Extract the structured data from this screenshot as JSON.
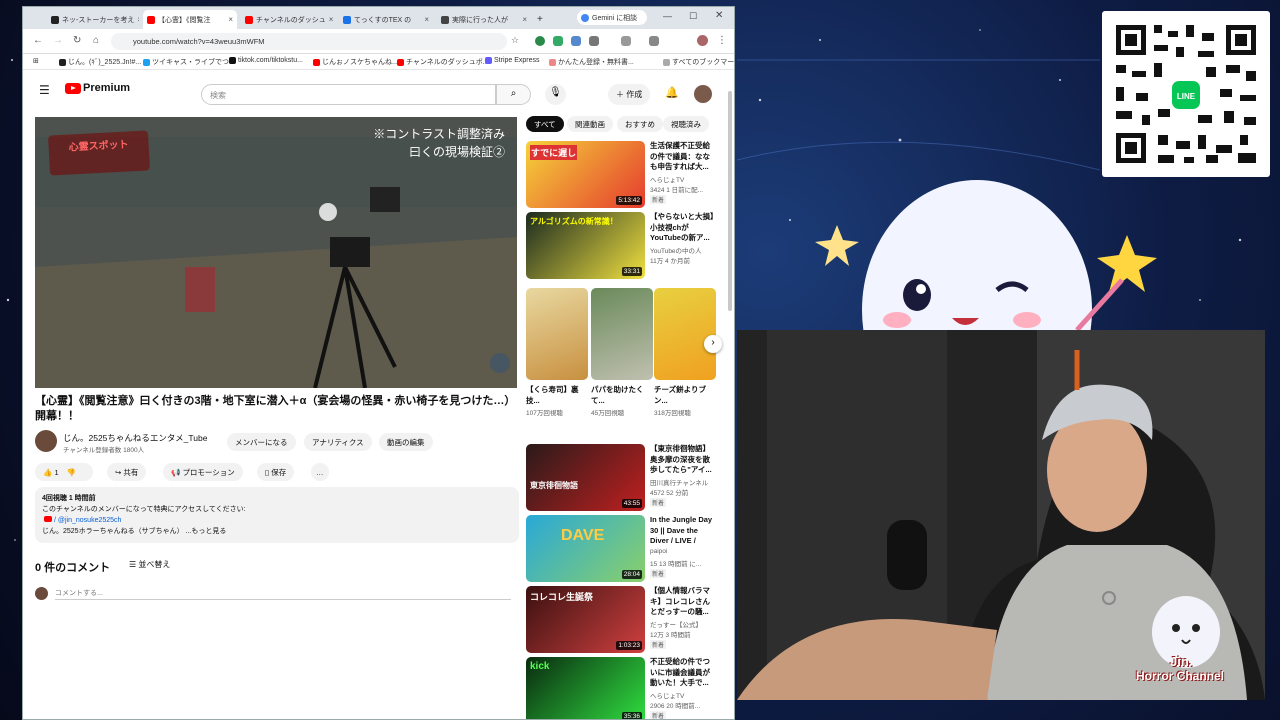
{
  "browser": {
    "tabs": [
      {
        "label": "ネッ-ストーカーを考え",
        "color": "#222"
      },
      {
        "label": "【心霊】《閲覧注",
        "color": "#f00"
      },
      {
        "label": "チャンネルのダッシュ",
        "color": "#f00"
      },
      {
        "label": "てっくすのTEX の",
        "color": "#1a73e8"
      },
      {
        "label": "実際に行った人が",
        "color": "#444"
      },
      {
        "label": "Gemini に相談",
        "color": "#4285f4"
      }
    ],
    "new_tab": "+",
    "url": "youtube.com/watch?v=43weuu3mWFM",
    "bookmarks": [
      {
        "label": "じん。(ｷﾞ)_2525.Jn!#...",
        "color": "#222"
      },
      {
        "label": "ツイキャス・ライブでつ...",
        "color": "#1da1f2"
      },
      {
        "label": "tiktok.com/tiktokstu...",
        "color": "#111"
      },
      {
        "label": "じんぉノスケちゃんね...",
        "color": "#f00"
      },
      {
        "label": "チャンネルのダッシュボ...",
        "color": "#f00"
      },
      {
        "label": "Stripe Express",
        "color": "#635bff"
      },
      {
        "label": "かんたん登録・無料書...",
        "color": "#e88"
      },
      {
        "label": "すべてのブックマーク",
        "color": "#888"
      }
    ]
  },
  "youtube": {
    "logo": "Premium",
    "search_placeholder": "検索",
    "create_label": "作成",
    "overlay_top_right": "※コントラスト調整済み",
    "overlay_sub": "曰くの現場検証②",
    "overlay_top_left": "心霊スポット",
    "video_title": "【心霊】《閲覧注意》曰く付きの3階・地下室に潜入＋α（宴会場の怪異・赤い椅子を見つけた…）開幕！！",
    "channel_name": "じん。2525ちゃんねるエンタメ_Tube",
    "subscribers": "チャンネル登録者数 1800人",
    "buttons": {
      "member": "メンバーになる",
      "analytics": "アナリティクス",
      "edit": "動画の編集",
      "like_count": "1",
      "share": "共有",
      "promote": "プロモーション",
      "save": "保存",
      "more": "…"
    },
    "description": {
      "meta": "4回視聴  1 時間前",
      "line1": "このチャンネルのメンバーになって特典にアクセスしてください:",
      "line2": "/ @jin_nosuke2525ch",
      "line3": "じん。2525ホラーちゃんねる（サブちゃん） ...もっと見る"
    },
    "comments_title": "0 件のコメント",
    "sort_label": "並べ替え",
    "comment_placeholder": "コメントする...",
    "filter_chips": [
      "すべて",
      "関連動画",
      "おすすめ",
      "視聴済み"
    ],
    "recommendations": [
      {
        "title": "生活保護不正受給の件で議員：ななも申告すれば大...",
        "channel": "へらじょTV",
        "stats": "3424 1 日前に配...",
        "badge": "新着",
        "duration": "5:13:42",
        "colors": [
          "#f5d33a",
          "#e53b2e"
        ]
      },
      {
        "title": "【やらないと大損】小技視chが YouTubeの新ア...",
        "channel": "YouTubeの中の人",
        "stats": "11万  4 か月前",
        "badge": "",
        "duration": "33:31",
        "colors": [
          "#1a2a20",
          "#f0e040"
        ]
      },
      {
        "title": "【東京徘徊物語】奥多摩の深夜を散歩してたら\"アイ...",
        "channel": "田川真行チャンネル",
        "stats": "4572  52 分前",
        "badge": "新着",
        "duration": "43:55",
        "colors": [
          "#2a1a1a",
          "#c02020"
        ]
      },
      {
        "title": "In the Jungle Day 30 || Dave the Diver / LIVE /",
        "channel": "paipoi",
        "stats": "15  13 時間前 に...",
        "badge": "新着",
        "duration": "28:04",
        "colors": [
          "#29a8d8",
          "#8ad06a"
        ]
      },
      {
        "title": "【個人情報バラマキ】コレコレさんとだっすーの騒...",
        "channel": "だっすー【公式】",
        "stats": "12万  3 時間前",
        "badge": "新着",
        "duration": "1:03:23",
        "colors": [
          "#3a1010",
          "#d04040"
        ]
      },
      {
        "title": "不正受給の件でついに市議会議員が動いた！大手で...",
        "channel": "へらじょTV",
        "stats": "2906  20 時間前...",
        "badge": "新着",
        "duration": "35:36",
        "colors": [
          "#0a2a10",
          "#30e040"
        ]
      }
    ],
    "shorts": [
      {
        "title": "【くら寿司】裏技...",
        "views": "107万回視聴",
        "colors": [
          "#e8d8a0",
          "#c89040"
        ]
      },
      {
        "title": "パパを助けたくて...",
        "views": "45万回視聴",
        "colors": [
          "#6a8a5a",
          "#c0c0b0"
        ]
      },
      {
        "title": "チーズ餅よりブン...",
        "views": "318万回視聴",
        "colors": [
          "#e8d040",
          "#f0a020"
        ]
      }
    ],
    "thumb_texts": [
      "すでに遅し",
      "アルゴリズムの新常識！",
      "東京徘徊物語",
      "DAVE",
      "コレコレ生誕祭",
      "kick"
    ]
  },
  "overlay": {
    "watermark": "Jin.",
    "watermark2": "Horror Channel"
  }
}
